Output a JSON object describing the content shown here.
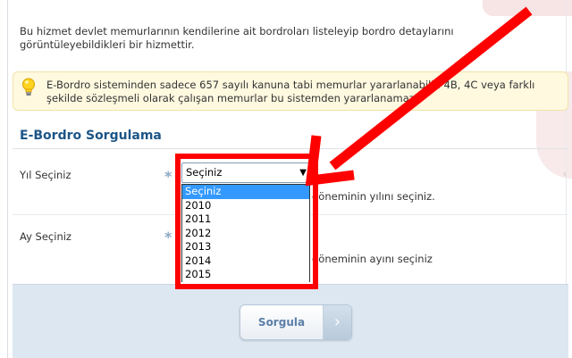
{
  "intro": {
    "text": "Bu hizmet devlet memurlarının kendilerine ait bordroları listeleyip bordro detaylarını görüntüleyebildikleri bir hizmettir."
  },
  "info": {
    "icon": "lightbulb-icon",
    "text": "E-Bordro sisteminden sadece 657 sayılı kanuna tabi memurlar yararlanabilir. 4B, 4C veya farklı şekilde sözleşmeli olarak çalışan memurlar bu sistemden yararlanamaz."
  },
  "form": {
    "title": "E-Bordro Sorgulama",
    "required_mark": "*",
    "year": {
      "label": "Yıl Seçiniz",
      "selected": "Seçiniz",
      "hint": "döneminin yılını seçiniz.",
      "options": [
        "Seçiniz",
        "2010",
        "2011",
        "2012",
        "2013",
        "2014",
        "2015"
      ]
    },
    "month": {
      "label": "Ay Seçiniz",
      "hint": "döneminin ayını seçiniz"
    },
    "submit_label": "Sorgula",
    "submit_arrow": "›"
  },
  "colors": {
    "title": "#1d5587",
    "annotation": "#ff0000",
    "option_highlight": "#3399ff",
    "info_bg": "#fff9e0",
    "panel_bg": "#dde7f1"
  }
}
